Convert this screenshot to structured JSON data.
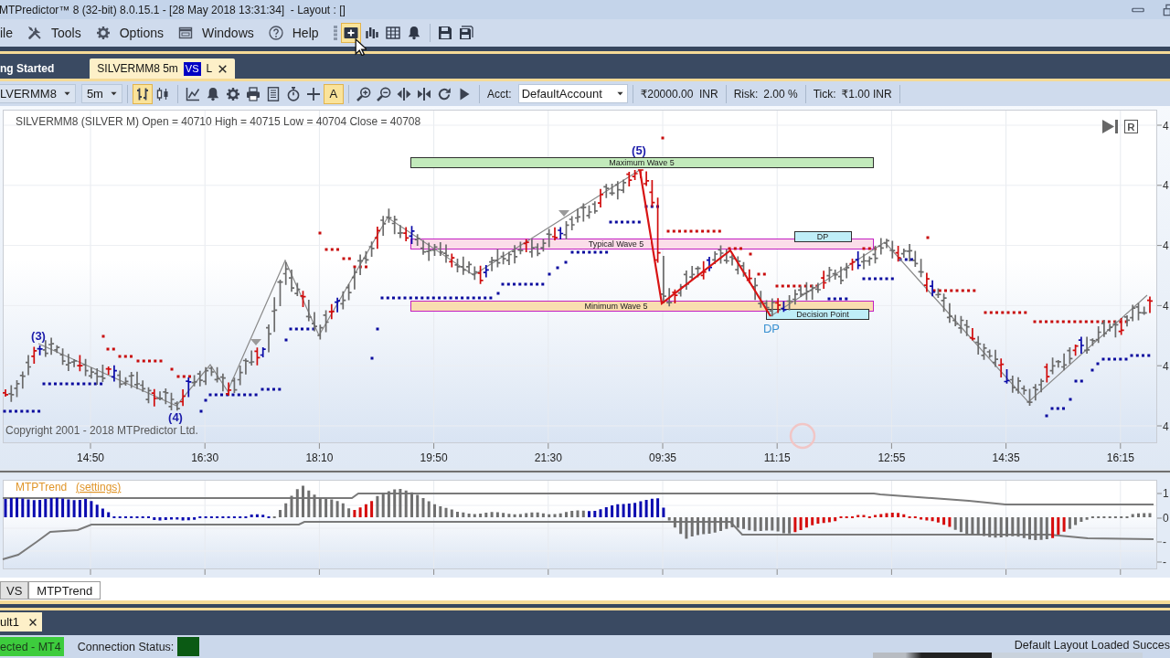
{
  "window": {
    "title": "MTPredictor™ 8 (32-bit) 8.0.15.1 - [28 May 2018 13:31:34]  - Layout : []"
  },
  "menu": [
    {
      "label": "ile",
      "kind": "file"
    },
    {
      "label": "Tools",
      "kind": "tools"
    },
    {
      "label": "Options",
      "kind": "options"
    },
    {
      "label": "Windows",
      "kind": "windows"
    },
    {
      "label": "Help",
      "kind": "help"
    }
  ],
  "toolbar": [
    [
      {
        "kind": "new-chart",
        "highlighted": true
      },
      {
        "kind": "bar-chart",
        "highlighted": false
      },
      {
        "kind": "table",
        "highlighted": false
      },
      {
        "kind": "alert",
        "highlighted": false
      }
    ],
    [
      {
        "kind": "save",
        "highlighted": false
      },
      {
        "kind": "save-all",
        "highlighted": false
      }
    ]
  ],
  "tabs": [
    {
      "label": "ng Started",
      "selected": false
    },
    {
      "label": "SILVERMM8 5m",
      "selected": true,
      "badge": "VS",
      "suffix": "L"
    }
  ],
  "chart_toolbar": {
    "symbol": "LVERMM8",
    "timeframe": "5m",
    "tool_groups": [
      [
        {
          "kind": "bars",
          "on": true
        },
        {
          "kind": "candles",
          "on": false
        }
      ],
      [
        {
          "kind": "line",
          "on": false
        },
        {
          "kind": "alert",
          "on": false
        },
        {
          "kind": "settings",
          "on": false
        },
        {
          "kind": "print",
          "on": false
        },
        {
          "kind": "list",
          "on": false
        },
        {
          "kind": "timer",
          "on": false
        },
        {
          "kind": "crosshair",
          "on": false
        },
        {
          "kind": "text",
          "label": "A",
          "on": true
        }
      ],
      [
        {
          "kind": "zoom-in",
          "on": false
        },
        {
          "kind": "zoom-out",
          "on": false
        },
        {
          "kind": "compress",
          "on": false
        },
        {
          "kind": "expand",
          "on": false
        },
        {
          "kind": "refresh",
          "on": false
        },
        {
          "kind": "play",
          "on": false
        }
      ]
    ],
    "account_label": "Acct:",
    "account": "DefaultAccount",
    "balance": "₹20000.00  INR",
    "risk_label": "Risk:",
    "risk": "2.00 %",
    "tick_label": "Tick:",
    "tick": "₹1.00 INR"
  },
  "chart": {
    "title": "SILVERMM8 (SILVER M) Open = 40710 High = 40715 Low = 40704 Close = 40708",
    "corner_buttons": [
      {
        "kind": "go-to-end"
      },
      {
        "kind": "reset",
        "label": "R"
      }
    ],
    "zones": [
      {
        "kind": "maximum",
        "label": "Maximum Wave 5"
      },
      {
        "kind": "typical",
        "label": "Typical Wave 5"
      },
      {
        "kind": "minimum",
        "label": "Minimum Wave 5"
      },
      {
        "kind": "dp",
        "label": "DP"
      },
      {
        "kind": "decision",
        "label": "Decision Point"
      }
    ],
    "wave_labels": [
      "(3)",
      "(4)",
      "(5)"
    ],
    "dp_label": "DP",
    "copyright": "Copyright 2001 - 2018 MTPredictor Ltd.",
    "x_axis_labels": [
      "14:50",
      "16:30",
      "18:10",
      "19:50",
      "21:30",
      "09:35",
      "11:15",
      "12:55",
      "14:35",
      "16:15"
    ],
    "y_axis_labels": [
      "4",
      "4",
      "4",
      "4",
      "4",
      "4"
    ]
  },
  "indicator": {
    "title": "MTPTrend",
    "settings_link": "(settings)",
    "y_axis_labels": [
      "1",
      "0",
      "-",
      "-"
    ]
  },
  "panel_tabs": [
    {
      "label": "VS",
      "selected": false
    },
    {
      "label": "MTPTrend",
      "selected": true
    }
  ],
  "document_tabs": [
    {
      "label": "ult1",
      "selected": true
    }
  ],
  "status_bar": {
    "connection": "ected - MT4",
    "status_label": "Connection Status:",
    "message": "Default Layout Loaded Succes"
  }
}
